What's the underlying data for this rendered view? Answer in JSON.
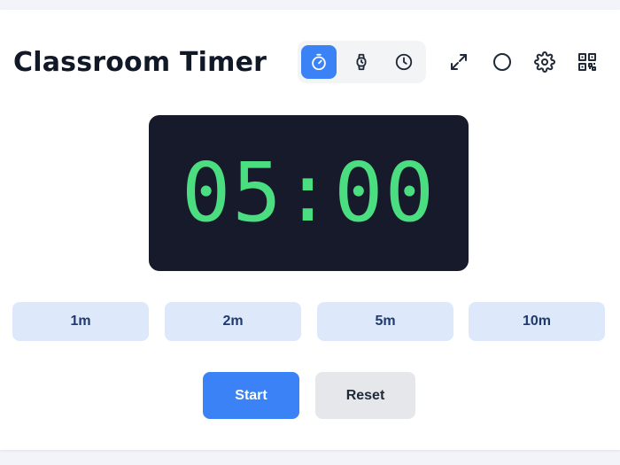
{
  "app": {
    "title": "Classroom Timer"
  },
  "mode_switcher": {
    "modes": [
      {
        "icon": "timer-icon",
        "active": true
      },
      {
        "icon": "stopwatch-icon",
        "active": false
      },
      {
        "icon": "clock-icon",
        "active": false
      }
    ]
  },
  "toolbar": {
    "buttons": [
      {
        "icon": "fullscreen-icon"
      },
      {
        "icon": "circle-icon"
      },
      {
        "icon": "gear-icon"
      },
      {
        "icon": "qr-code-icon"
      }
    ]
  },
  "display": {
    "time": "05:00"
  },
  "presets": [
    {
      "label": "1m"
    },
    {
      "label": "2m"
    },
    {
      "label": "5m"
    },
    {
      "label": "10m"
    }
  ],
  "actions": {
    "start_label": "Start",
    "reset_label": "Reset"
  },
  "colors": {
    "accent": "#3b82f6",
    "display_bg": "#161a2b",
    "digits": "#4ade80",
    "preset_bg": "#dde8fb"
  }
}
